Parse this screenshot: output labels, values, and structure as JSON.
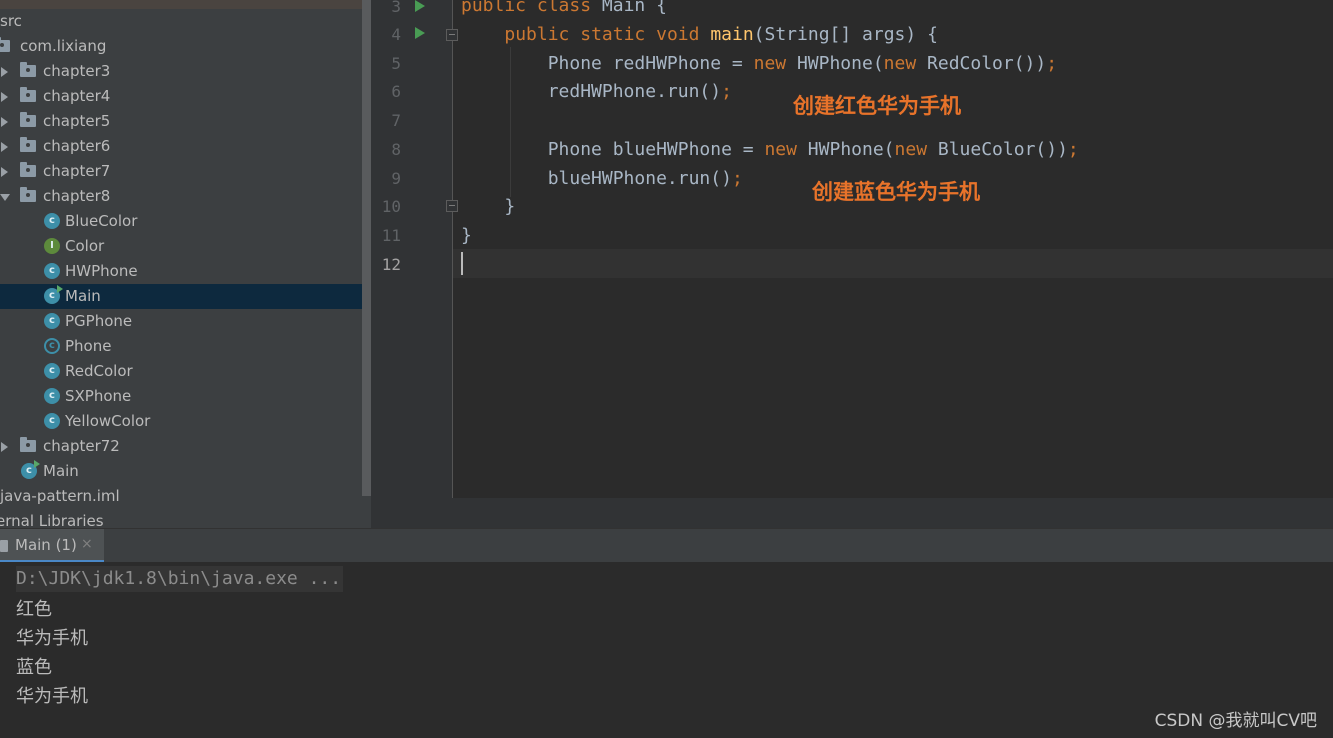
{
  "project_tree": {
    "items": [
      {
        "label": "src",
        "type": "folder"
      },
      {
        "label": "com.lixiang",
        "type": "package"
      },
      {
        "label": "chapter3",
        "type": "package",
        "expanded": false
      },
      {
        "label": "chapter4",
        "type": "package",
        "expanded": false
      },
      {
        "label": "chapter5",
        "type": "package",
        "expanded": false
      },
      {
        "label": "chapter6",
        "type": "package",
        "expanded": false
      },
      {
        "label": "chapter7",
        "type": "package",
        "expanded": false
      },
      {
        "label": "chapter8",
        "type": "package",
        "expanded": true
      },
      {
        "label": "BlueColor",
        "type": "class"
      },
      {
        "label": "Color",
        "type": "interface"
      },
      {
        "label": "HWPhone",
        "type": "class"
      },
      {
        "label": "Main",
        "type": "class",
        "selected": true
      },
      {
        "label": "PGPhone",
        "type": "class"
      },
      {
        "label": "Phone",
        "type": "abstract"
      },
      {
        "label": "RedColor",
        "type": "class"
      },
      {
        "label": "SXPhone",
        "type": "class"
      },
      {
        "label": "YellowColor",
        "type": "class"
      },
      {
        "label": "chapter72",
        "type": "package",
        "expanded": false
      },
      {
        "label": "Main",
        "type": "class"
      },
      {
        "label": "java-pattern.iml",
        "type": "file"
      },
      {
        "label": "ernal Libraries",
        "type": "library"
      }
    ]
  },
  "editor": {
    "line_numbers": [
      "3",
      "4",
      "5",
      "6",
      "7",
      "8",
      "9",
      "10",
      "11",
      "12"
    ],
    "current_line": "12",
    "lines": {
      "l3": {
        "kw1": "public",
        "kw2": "class",
        "rest": " Main {"
      },
      "l4": {
        "indent": "    ",
        "kw1": "public",
        "kw2": "static",
        "kw3": "void",
        "fn": "main",
        "rest": "(String[] args) {"
      },
      "l5": {
        "indent": "        ",
        "a": "Phone redHWPhone = ",
        "kw1": "new",
        "b": " HWPhone(",
        "kw2": "new",
        "c": " RedColor())",
        "semi": ";"
      },
      "l6": {
        "indent": "        ",
        "a": "redHWPhone.run()",
        "semi": ";"
      },
      "l8": {
        "indent": "        ",
        "a": "Phone blueHWPhone = ",
        "kw1": "new",
        "b": " HWPhone(",
        "kw2": "new",
        "c": " BlueColor())",
        "semi": ";"
      },
      "l9": {
        "indent": "        ",
        "a": "blueHWPhone.run()",
        "semi": ";"
      },
      "l10": {
        "text": "    }"
      },
      "l11": {
        "text": "}"
      }
    },
    "annotations": {
      "red": "创建红色华为手机",
      "blue": "创建蓝色华为手机"
    }
  },
  "run_panel": {
    "tab_label": "Main (1)",
    "close_glyph": "×",
    "command": "D:\\JDK\\jdk1.8\\bin\\java.exe ...",
    "output": [
      "红色",
      "华为手机",
      "蓝色",
      "华为手机"
    ]
  },
  "watermark": "CSDN @我就叫CV吧",
  "colors": {
    "keyword": "#cc7832",
    "method": "#ffc66d",
    "annotation": "#e8732a",
    "selection": "#0d293e",
    "tab_accent": "#4a88c7"
  }
}
